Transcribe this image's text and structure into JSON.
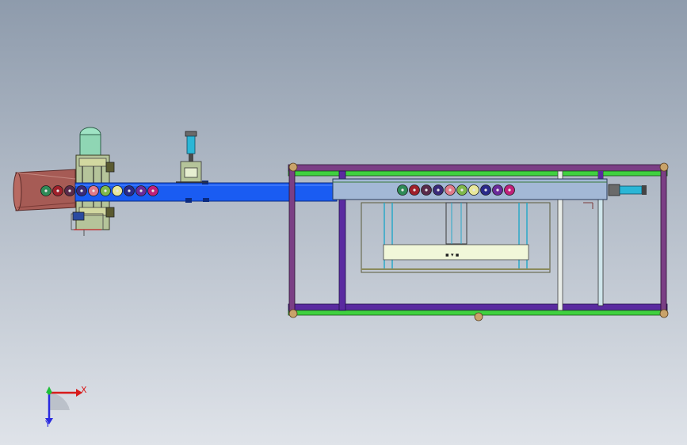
{
  "triad": {
    "x_label": "X",
    "y_label": "Y",
    "x_color": "#d81b1b",
    "y_color": "#2a2ae0",
    "origin_color": "#1fbf3a"
  },
  "colors": {
    "conveyor": "#1a5cf2",
    "frame_magenta": "#7b3f85",
    "frame_green": "#3fd13f",
    "frame_purple": "#5a2aa0",
    "panel_pale": "#f1f7d9",
    "hopper": "#a85a52",
    "motor": "#8fd9b8"
  },
  "disc_colors": [
    "#2e8b57",
    "#a0202a",
    "#5a2a4a",
    "#3a2a7a",
    "#e07a8a",
    "#7fb84a",
    "#e8e89a",
    "#2a2a8a",
    "#6a2a9a",
    "#c0207a"
  ]
}
